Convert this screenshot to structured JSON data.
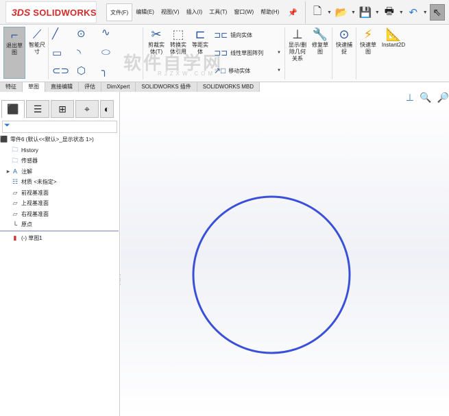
{
  "app": {
    "logo_prefix": "3DS",
    "logo": "SOLIDWORKS"
  },
  "menu": [
    {
      "label": "文件(F)"
    },
    {
      "label": "编辑(E)"
    },
    {
      "label": "视图(V)"
    },
    {
      "label": "插入(I)"
    },
    {
      "label": "工具(T)"
    },
    {
      "label": "窗口(W)"
    },
    {
      "label": "帮助(H)"
    }
  ],
  "ribbon": {
    "exit_sketch": "退出草图",
    "smart_dim": "智能尺寸",
    "trim": "剪裁实体(T)",
    "convert": "转换实体引用",
    "offset": "等距实体",
    "mirror": "镜向实体",
    "linear_pattern": "线性草图阵列",
    "move": "移动实体",
    "display_relations": "显示/删除几何关系",
    "repair": "修复草图",
    "quick_snap": "快速捕捉",
    "rapid_sketch": "快速草图",
    "instant2d": "Instant2D"
  },
  "tabs": [
    {
      "label": "特征"
    },
    {
      "label": "草图",
      "active": true
    },
    {
      "label": "直接编辑"
    },
    {
      "label": "评估"
    },
    {
      "label": "DimXpert"
    },
    {
      "label": "SOLIDWORKS 插件"
    },
    {
      "label": "SOLIDWORKS MBD"
    }
  ],
  "tree": {
    "root": "零件6  (默认<<默认>_显示状态 1>)",
    "items": [
      {
        "label": "History"
      },
      {
        "label": "传感器"
      },
      {
        "label": "注解"
      },
      {
        "label": "材质 <未指定>"
      },
      {
        "label": "前视基准面"
      },
      {
        "label": "上视基准面"
      },
      {
        "label": "右视基准面"
      },
      {
        "label": "原点"
      }
    ],
    "sketch": "(-) 草图1"
  },
  "watermark": {
    "text": "软件自学网",
    "url": "RJZXW.COM"
  },
  "colors": {
    "circle": "#3a50d8",
    "accent": "#d42a2a"
  }
}
